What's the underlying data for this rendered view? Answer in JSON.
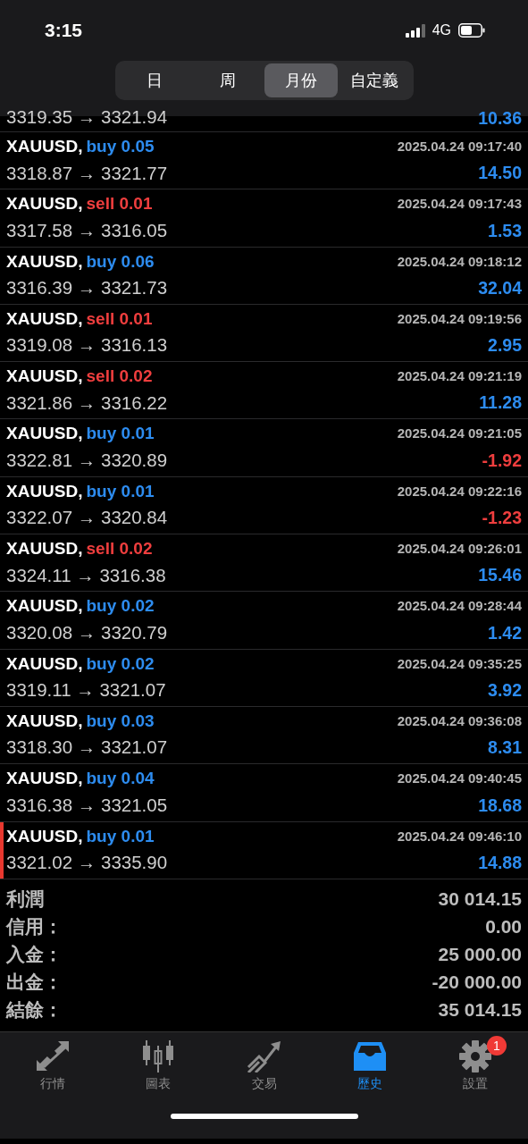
{
  "status_bar": {
    "time": "3:15",
    "network": "4G"
  },
  "period_tabs": [
    {
      "label": "日",
      "selected": false
    },
    {
      "label": "周",
      "selected": false
    },
    {
      "label": "月份",
      "selected": true
    },
    {
      "label": "自定義",
      "selected": false
    }
  ],
  "partial_row": {
    "prices": "3319.35 → 3321.94",
    "profit": "10.36",
    "loss": false
  },
  "trades": [
    {
      "symbol": "XAUUSD,",
      "kind": "buy",
      "order": "buy 0.05",
      "time": "2025.04.24 09:17:40",
      "prices": "3318.87 → 3321.77",
      "profit": "14.50",
      "loss": false,
      "marked": false
    },
    {
      "symbol": "XAUUSD,",
      "kind": "sell",
      "order": "sell 0.01",
      "time": "2025.04.24 09:17:43",
      "prices": "3317.58 → 3316.05",
      "profit": "1.53",
      "loss": false,
      "marked": false
    },
    {
      "symbol": "XAUUSD,",
      "kind": "buy",
      "order": "buy 0.06",
      "time": "2025.04.24 09:18:12",
      "prices": "3316.39 → 3321.73",
      "profit": "32.04",
      "loss": false,
      "marked": false
    },
    {
      "symbol": "XAUUSD,",
      "kind": "sell",
      "order": "sell 0.01",
      "time": "2025.04.24 09:19:56",
      "prices": "3319.08 → 3316.13",
      "profit": "2.95",
      "loss": false,
      "marked": false
    },
    {
      "symbol": "XAUUSD,",
      "kind": "sell",
      "order": "sell 0.02",
      "time": "2025.04.24 09:21:19",
      "prices": "3321.86 → 3316.22",
      "profit": "11.28",
      "loss": false,
      "marked": false
    },
    {
      "symbol": "XAUUSD,",
      "kind": "buy",
      "order": "buy 0.01",
      "time": "2025.04.24 09:21:05",
      "prices": "3322.81 → 3320.89",
      "profit": "-1.92",
      "loss": true,
      "marked": false
    },
    {
      "symbol": "XAUUSD,",
      "kind": "buy",
      "order": "buy 0.01",
      "time": "2025.04.24 09:22:16",
      "prices": "3322.07 → 3320.84",
      "profit": "-1.23",
      "loss": true,
      "marked": false
    },
    {
      "symbol": "XAUUSD,",
      "kind": "sell",
      "order": "sell 0.02",
      "time": "2025.04.24 09:26:01",
      "prices": "3324.11 → 3316.38",
      "profit": "15.46",
      "loss": false,
      "marked": false
    },
    {
      "symbol": "XAUUSD,",
      "kind": "buy",
      "order": "buy 0.02",
      "time": "2025.04.24 09:28:44",
      "prices": "3320.08 → 3320.79",
      "profit": "1.42",
      "loss": false,
      "marked": false
    },
    {
      "symbol": "XAUUSD,",
      "kind": "buy",
      "order": "buy 0.02",
      "time": "2025.04.24 09:35:25",
      "prices": "3319.11 → 3321.07",
      "profit": "3.92",
      "loss": false,
      "marked": false
    },
    {
      "symbol": "XAUUSD,",
      "kind": "buy",
      "order": "buy 0.03",
      "time": "2025.04.24 09:36:08",
      "prices": "3318.30 → 3321.07",
      "profit": "8.31",
      "loss": false,
      "marked": false
    },
    {
      "symbol": "XAUUSD,",
      "kind": "buy",
      "order": "buy 0.04",
      "time": "2025.04.24 09:40:45",
      "prices": "3316.38 → 3321.05",
      "profit": "18.68",
      "loss": false,
      "marked": false
    },
    {
      "symbol": "XAUUSD,",
      "kind": "buy",
      "order": "buy 0.01",
      "time": "2025.04.24 09:46:10",
      "prices": "3321.02 → 3335.90",
      "profit": "14.88",
      "loss": false,
      "marked": true
    }
  ],
  "summary": [
    {
      "label": "利潤",
      "value": "30 014.15"
    },
    {
      "label": "信用：",
      "value": "0.00"
    },
    {
      "label": "入金：",
      "value": "25 000.00"
    },
    {
      "label": "出金：",
      "value": "-20 000.00"
    },
    {
      "label": "結餘：",
      "value": "35 014.15"
    }
  ],
  "bottom_tabs": [
    {
      "kind": "quotes",
      "label": "行情",
      "selected": false
    },
    {
      "kind": "chart",
      "label": "圖表",
      "selected": false
    },
    {
      "kind": "trade",
      "label": "交易",
      "selected": false
    },
    {
      "kind": "history",
      "label": "歷史",
      "selected": true
    },
    {
      "kind": "settings",
      "label": "設置",
      "selected": false,
      "badge": "1"
    }
  ]
}
